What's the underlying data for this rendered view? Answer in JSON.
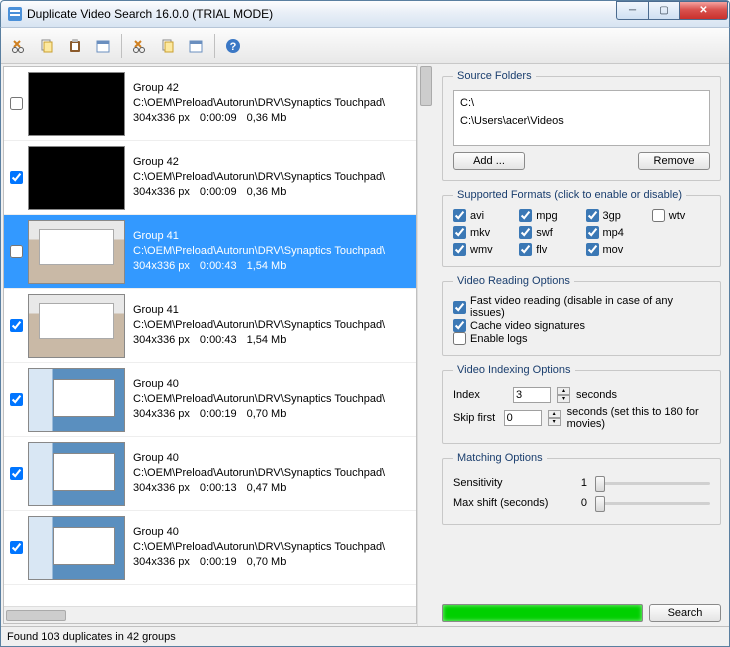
{
  "window": {
    "title": "Duplicate Video Search 16.0.0 (TRIAL MODE)"
  },
  "toolbar_icons": [
    "cut-icon",
    "copy-icon",
    "paste-icon",
    "calendar-icon",
    "cut-icon",
    "copy-icon",
    "calendar-icon",
    "help-icon"
  ],
  "status": "Found 103 duplicates in 42 groups",
  "list": [
    {
      "checked": false,
      "thumb": "black",
      "group": "Group 42",
      "path": "C:\\OEM\\Preload\\Autorun\\DRV\\Synaptics Touchpad\\",
      "res": "304x336 px",
      "dur": "0:00:09",
      "size": "0,36 Mb",
      "selected": false
    },
    {
      "checked": true,
      "thumb": "black",
      "group": "Group 42",
      "path": "C:\\OEM\\Preload\\Autorun\\DRV\\Synaptics Touchpad\\",
      "res": "304x336 px",
      "dur": "0:00:09",
      "size": "0,36 Mb",
      "selected": false
    },
    {
      "checked": false,
      "thumb": "light",
      "group": "Group 41",
      "path": "C:\\OEM\\Preload\\Autorun\\DRV\\Synaptics Touchpad\\",
      "res": "304x336 px",
      "dur": "0:00:43",
      "size": "1,54 Mb",
      "selected": true
    },
    {
      "checked": true,
      "thumb": "light",
      "group": "Group 41",
      "path": "C:\\OEM\\Preload\\Autorun\\DRV\\Synaptics Touchpad\\",
      "res": "304x336 px",
      "dur": "0:00:43",
      "size": "1,54 Mb",
      "selected": false
    },
    {
      "checked": true,
      "thumb": "blue",
      "group": "Group 40",
      "path": "C:\\OEM\\Preload\\Autorun\\DRV\\Synaptics Touchpad\\",
      "res": "304x336 px",
      "dur": "0:00:19",
      "size": "0,70 Mb",
      "selected": false
    },
    {
      "checked": true,
      "thumb": "blue",
      "group": "Group 40",
      "path": "C:\\OEM\\Preload\\Autorun\\DRV\\Synaptics Touchpad\\",
      "res": "304x336 px",
      "dur": "0:00:13",
      "size": "0,47 Mb",
      "selected": false
    },
    {
      "checked": true,
      "thumb": "blue",
      "group": "Group 40",
      "path": "C:\\OEM\\Preload\\Autorun\\DRV\\Synaptics Touchpad\\",
      "res": "304x336 px",
      "dur": "0:00:19",
      "size": "0,70 Mb",
      "selected": false
    }
  ],
  "source": {
    "legend": "Source Folders",
    "folders": [
      "C:\\",
      "C:\\Users\\acer\\Videos"
    ],
    "add": "Add ...",
    "remove": "Remove"
  },
  "formats": {
    "legend": "Supported Formats (click to enable or disable)",
    "items": [
      {
        "label": "avi",
        "checked": true
      },
      {
        "label": "mpg",
        "checked": true
      },
      {
        "label": "3gp",
        "checked": true
      },
      {
        "label": "wtv",
        "checked": false
      },
      {
        "label": "mkv",
        "checked": true
      },
      {
        "label": "swf",
        "checked": true
      },
      {
        "label": "mp4",
        "checked": true
      },
      {
        "label": "",
        "checked": null
      },
      {
        "label": "wmv",
        "checked": true
      },
      {
        "label": "flv",
        "checked": true
      },
      {
        "label": "mov",
        "checked": true
      },
      {
        "label": "",
        "checked": null
      }
    ]
  },
  "reading": {
    "legend": "Video Reading Options",
    "fast": {
      "label": "Fast video reading (disable in case of any issues)",
      "checked": true
    },
    "cache": {
      "label": "Cache video signatures",
      "checked": true
    },
    "logs": {
      "label": "Enable logs",
      "checked": false
    }
  },
  "indexing": {
    "legend": "Video Indexing Options",
    "index_label": "Index",
    "index_value": "3",
    "index_unit": "seconds",
    "skip_label": "Skip first",
    "skip_value": "0",
    "skip_unit": "seconds (set this to 180 for movies)"
  },
  "matching": {
    "legend": "Matching Options",
    "sensitivity_label": "Sensitivity",
    "sensitivity_value": "1",
    "maxshift_label": "Max shift (seconds)",
    "maxshift_value": "0"
  },
  "search_button": "Search"
}
